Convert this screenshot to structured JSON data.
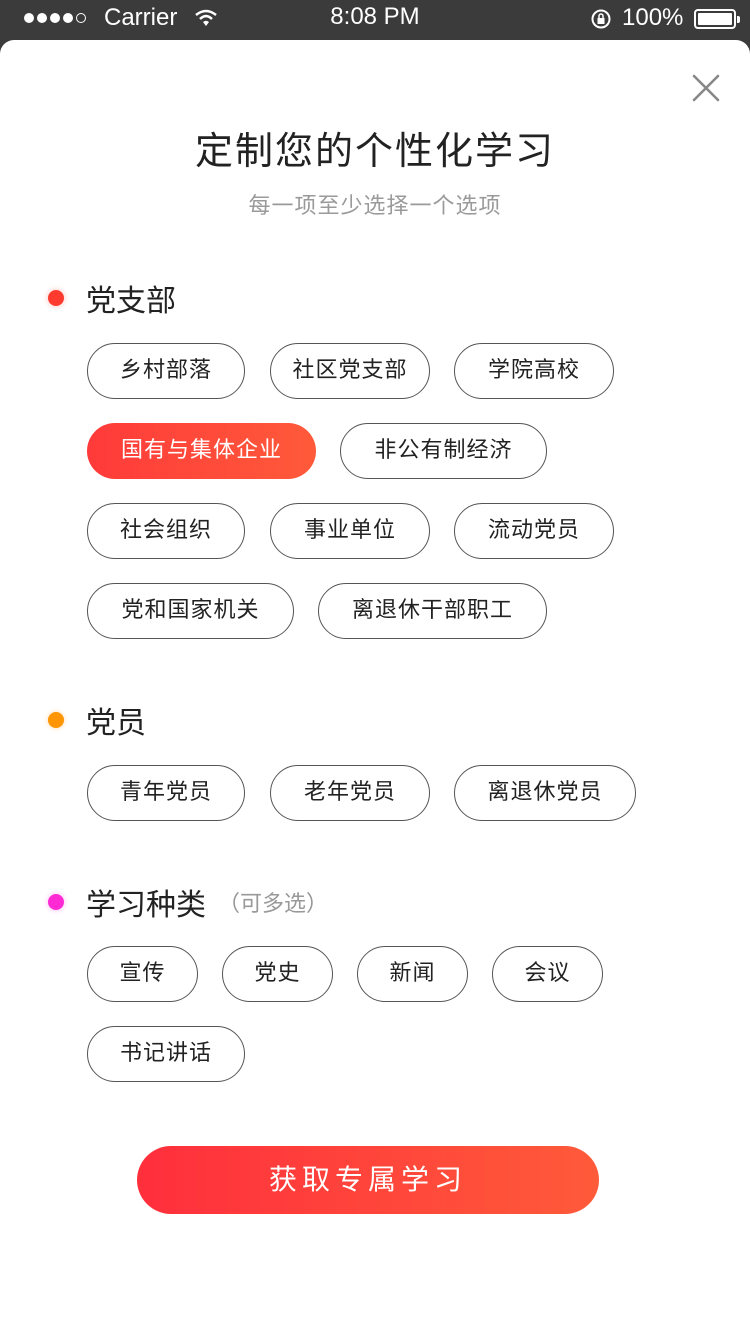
{
  "status_bar": {
    "carrier": "Carrier",
    "time": "8:08 PM",
    "battery": "100%"
  },
  "modal": {
    "title": "定制您的个性化学习",
    "subtitle": "每一项至少选择一个选项"
  },
  "sections": [
    {
      "label": "党支部",
      "dot_color": "#ff3b30",
      "options": [
        "乡村部落",
        "社区党支部",
        "学院高校",
        "国有与集体企业",
        "非公有制经济",
        "社会组织",
        "事业单位",
        "流动党员",
        "党和国家机关",
        "离退休干部职工"
      ],
      "selected": "国有与集体企业"
    },
    {
      "label": "党员",
      "dot_color": "#ff9500",
      "options": [
        "青年党员",
        "老年党员",
        "离退休党员"
      ]
    },
    {
      "label": "学习种类",
      "hint": "（可多选）",
      "dot_color": "#ff2ad4",
      "options": [
        "宣传",
        "党史",
        "新闻",
        "会议",
        "书记讲话"
      ]
    }
  ],
  "cta": {
    "label": "获取专属学习"
  },
  "colors": {
    "accent": "#ff3b3b",
    "accent_end": "#ff5a3a"
  }
}
